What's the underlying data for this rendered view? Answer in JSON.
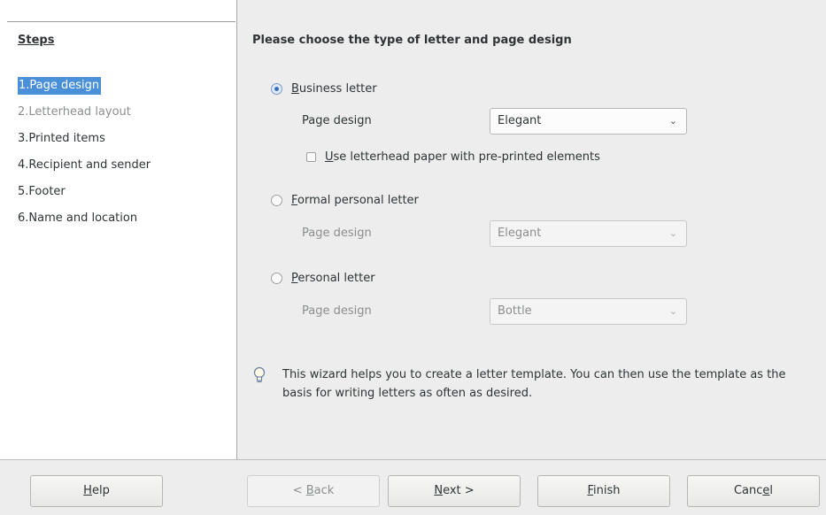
{
  "sidebar": {
    "title": "Steps",
    "steps": [
      {
        "num": "1.",
        "label": "Page design"
      },
      {
        "num": "2.",
        "label": "Letterhead layout"
      },
      {
        "num": "3.",
        "label": "Printed items"
      },
      {
        "num": "4.",
        "label": "Recipient and sender"
      },
      {
        "num": "5.",
        "label": "Footer"
      },
      {
        "num": "6.",
        "label": "Name and location"
      }
    ]
  },
  "main": {
    "title": "Please choose the type of letter and page design",
    "options": [
      {
        "key": "B",
        "rest": "usiness letter",
        "page_design_label": "Page design",
        "page_design_value": "Elegant",
        "selected": true
      },
      {
        "key": "F",
        "rest": "ormal personal letter",
        "page_design_label": "Page design",
        "page_design_value": "Elegant",
        "selected": false
      },
      {
        "key": "P",
        "rest": "ersonal letter",
        "page_design_label": "Page design",
        "page_design_value": "Bottle",
        "selected": false
      }
    ],
    "letterhead_checkbox": {
      "key": "U",
      "rest": "se letterhead paper with pre-printed elements",
      "checked": false
    },
    "info_text": "This wizard helps you to create a letter template. You can then use the template as the basis for writing letters as often as desired."
  },
  "buttons": {
    "help": {
      "key": "H",
      "rest": "elp"
    },
    "back": {
      "pre": "< ",
      "key": "B",
      "rest": "ack"
    },
    "next": {
      "key": "N",
      "rest": "ext >"
    },
    "finish": {
      "key": "F",
      "rest": "inish"
    },
    "cancel": {
      "pre": "Canc",
      "key": "e",
      "rest": "l"
    }
  },
  "icons": {
    "bulb": "lightbulb-icon",
    "chevron": "chevron-down-icon"
  },
  "colors": {
    "selection": "#4a90d9",
    "radio_accent": "#3d6fb8"
  }
}
